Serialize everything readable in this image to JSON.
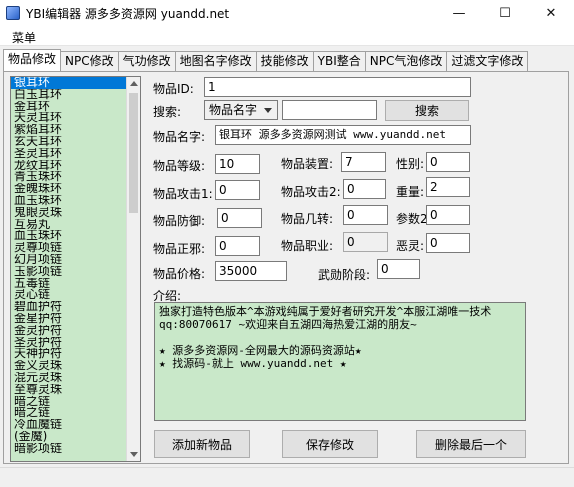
{
  "window": {
    "title": "YBI编辑器 源多多资源网  yuandd.net",
    "minimize": "—",
    "maximize": "☐",
    "close": "✕"
  },
  "menu": {
    "label": "菜单"
  },
  "tabs": [
    {
      "label": "物品修改",
      "active": true
    },
    {
      "label": "NPC修改"
    },
    {
      "label": "气功修改"
    },
    {
      "label": "地图名字修改"
    },
    {
      "label": "技能修改"
    },
    {
      "label": "YBI整合"
    },
    {
      "label": "NPC气泡修改"
    },
    {
      "label": "过滤文字修改"
    }
  ],
  "item_list": [
    "银耳环",
    "白玉耳环",
    "金耳环",
    "天灵耳环",
    "紫焰耳环",
    "玄天耳环",
    "圣灵耳环",
    "龙纹耳环",
    "青玉珠环",
    "金魄珠环",
    "血玉珠环",
    "鬼眼灵珠",
    "互易丸",
    "血玉珠环",
    "灵尊项链",
    "幻月项链",
    "玉影项链",
    "五毒链",
    "灵心链",
    "碧血护符",
    "金星护符",
    "金灵护符",
    "圣灵护符",
    "天神护符",
    "金义灵珠",
    "混元灵珠",
    "至尊灵珠",
    "暗之链",
    "暗之链",
    "冷血魔链",
    "(金魔)",
    "暗影项链"
  ],
  "form": {
    "id_label": "物品ID:",
    "id_value": "1",
    "search_label": "搜索:",
    "search_option": "物品名字",
    "search_value": "",
    "search_button": "搜索",
    "name_label": "物品名字:",
    "name_value": "银耳环 源多多资源网测试 www.yuandd.net",
    "level_label": "物品等级:",
    "level_value": "10",
    "equip_label": "物品装置:",
    "equip_value": "7",
    "gender_label": "性别:",
    "gender_value": "0",
    "attack1_label": "物品攻击1:",
    "attack1_value": "0",
    "attack2_label": "物品攻击2:",
    "attack2_value": "0",
    "weight_label": "重量:",
    "weight_value": "2",
    "defense_label": "物品防御:",
    "defense_value": "0",
    "turn_label": "物品几转:",
    "turn_value": "0",
    "param2_label": "参数2:",
    "param2_value": "0",
    "righteous_label": "物品正邪:",
    "righteous_value": "0",
    "job_label": "物品职业:",
    "job_value": "0",
    "evil_label": "恶灵:",
    "evil_value": "0",
    "price_label": "物品价格:",
    "price_value": "35000",
    "martial_label": "武勋阶段:",
    "martial_value": "0",
    "desc_label": "介绍:",
    "desc_lines": [
      "独家打造特色版本^本游戏纯属于爱好者研究开发^本服江湖唯一技术",
      "qq:80070617 ~欢迎来自五湖四海热爱江湖的朋友~",
      "",
      "★ 源多多资源网-全网最大的源码资源站★",
      "   ★ 找源码-就上 www.yuandd.net ★"
    ]
  },
  "buttons": {
    "add": "添加新物品",
    "save": "保存修改",
    "delete_last": "删除最后一个"
  }
}
